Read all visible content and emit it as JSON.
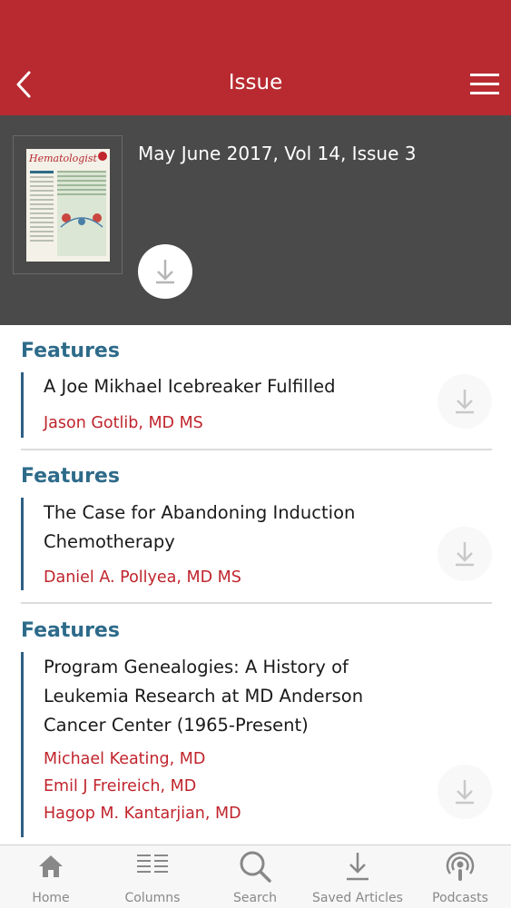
{
  "header": {
    "title": "Issue"
  },
  "issue": {
    "title": "May June 2017, Vol 14, Issue 3",
    "cover_masthead": "Hematologist"
  },
  "features": [
    {
      "category": "Features",
      "title_lines": [
        "A Joe Mikhael Icebreaker Fulfilled"
      ],
      "authors": [
        "Jason Gotlib, MD MS"
      ]
    },
    {
      "category": "Features",
      "title_lines": [
        "The Case for Abandoning Induction",
        "Chemotherapy"
      ],
      "authors": [
        "Daniel A. Pollyea, MD MS"
      ]
    },
    {
      "category": "Features",
      "title_lines": [
        "Program Genealogies: A History of",
        "Leukemia Research at MD Anderson",
        "Cancer Center (1965-Present)"
      ],
      "authors": [
        "Michael Keating, MD",
        "Emil J Freireich, MD",
        "Hagop M. Kantarjian, MD"
      ]
    }
  ],
  "tabbar": {
    "home": "Home",
    "columns": "Columns",
    "search": "Search",
    "saved": "Saved Articles",
    "podcasts": "Podcasts"
  },
  "colors": {
    "brand": "#b82a30",
    "panel": "#4a4a4a",
    "category": "#2e6b8a",
    "author": "#c0242c"
  }
}
